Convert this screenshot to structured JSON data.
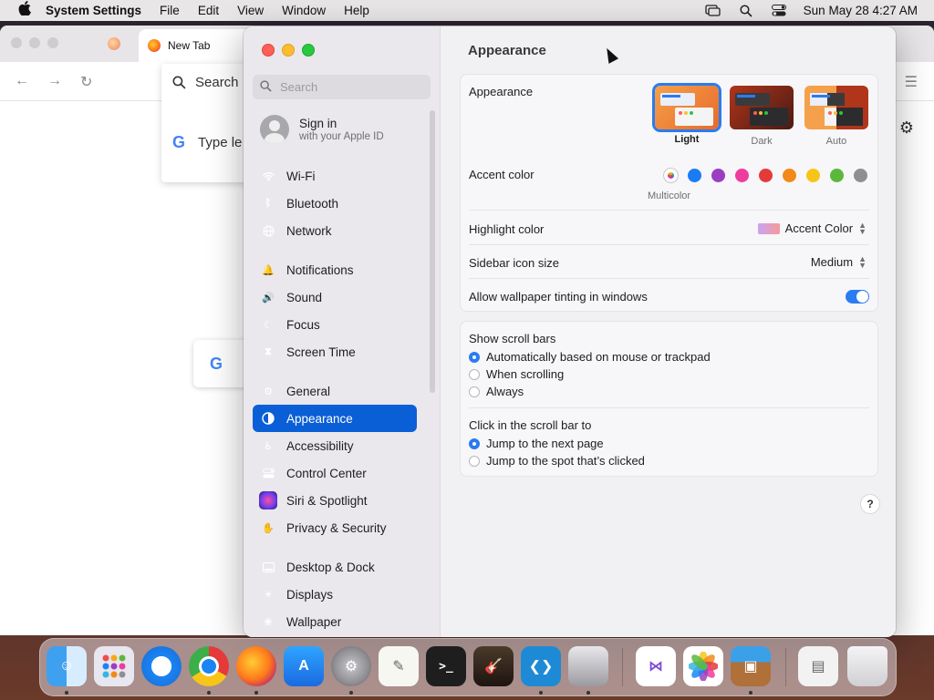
{
  "menubar": {
    "app_name": "System Settings",
    "menus": [
      "File",
      "Edit",
      "View",
      "Window",
      "Help"
    ],
    "datetime": "Sun May 28  4:27 AM"
  },
  "browser": {
    "tab_title": "New Tab",
    "search_text": "Search",
    "type_text": "Type le"
  },
  "sidebar": {
    "search_placeholder": "Search",
    "signin_title": "Sign in",
    "signin_subtitle": "with your Apple ID",
    "items": [
      {
        "label": "Wi-Fi",
        "color": "#1a84f4"
      },
      {
        "label": "Bluetooth",
        "color": "#1a84f4"
      },
      {
        "label": "Network",
        "color": "#1a84f4"
      },
      {
        "label": "Notifications",
        "color": "#f04c4c"
      },
      {
        "label": "Sound",
        "color": "#f04c6c"
      },
      {
        "label": "Focus",
        "color": "#5b4ddb"
      },
      {
        "label": "Screen Time",
        "color": "#5b4ddb"
      },
      {
        "label": "General",
        "color": "#8e8e93"
      },
      {
        "label": "Appearance",
        "color": "#1d1d1f"
      },
      {
        "label": "Accessibility",
        "color": "#1a84f4"
      },
      {
        "label": "Control Center",
        "color": "#8e8e93"
      },
      {
        "label": "Siri & Spotlight",
        "color": "#b33cc8"
      },
      {
        "label": "Privacy & Security",
        "color": "#1a84f4"
      },
      {
        "label": "Desktop & Dock",
        "color": "#1d1d1f"
      },
      {
        "label": "Displays",
        "color": "#1a84f4"
      },
      {
        "label": "Wallpaper",
        "color": "#36b5e0"
      }
    ]
  },
  "main": {
    "title": "Appearance",
    "appearance_label": "Appearance",
    "appearance_options": [
      "Light",
      "Dark",
      "Auto"
    ],
    "appearance_selected": "Light",
    "accent_label": "Accent color",
    "accent_colors": [
      "multicolor",
      "#1a7cf5",
      "#9a3fc1",
      "#ee3d9e",
      "#e53a3a",
      "#f28a1a",
      "#f7c51a",
      "#5cb83c",
      "#8e8e93"
    ],
    "accent_selected_label": "Multicolor",
    "highlight_label": "Highlight color",
    "highlight_value": "Accent Color",
    "sidebar_icon_label": "Sidebar icon size",
    "sidebar_icon_value": "Medium",
    "wallpaper_tinting_label": "Allow wallpaper tinting in windows",
    "wallpaper_tinting_on": true,
    "scrollbars_label": "Show scroll bars",
    "scrollbars_options": [
      "Automatically based on mouse or trackpad",
      "When scrolling",
      "Always"
    ],
    "click_label": "Click in the scroll bar to",
    "click_options": [
      "Jump to the next page",
      "Jump to the spot that’s clicked"
    ],
    "help": "?"
  }
}
